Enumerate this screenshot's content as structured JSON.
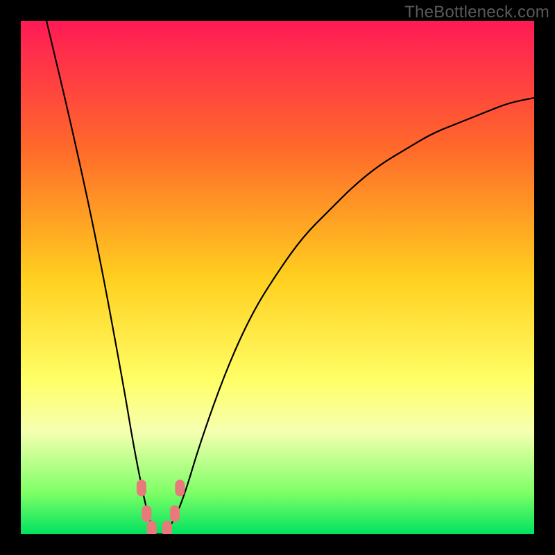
{
  "watermark": "TheBottleneck.com",
  "chart_data": {
    "type": "line",
    "title": "",
    "xlabel": "",
    "ylabel": "",
    "xlim": [
      0,
      100
    ],
    "ylim": [
      0,
      100
    ],
    "gradient_stops": [
      {
        "offset": 0,
        "color": "#ff1a55"
      },
      {
        "offset": 25,
        "color": "#ff6a2a"
      },
      {
        "offset": 50,
        "color": "#ffcf1f"
      },
      {
        "offset": 70,
        "color": "#ffff66"
      },
      {
        "offset": 80,
        "color": "#f6ffb0"
      },
      {
        "offset": 92,
        "color": "#7dff66"
      },
      {
        "offset": 100,
        "color": "#00e25f"
      }
    ],
    "series": [
      {
        "name": "bottleneck-curve",
        "x": [
          5,
          10,
          15,
          20,
          22,
          24,
          25,
          26,
          27,
          28,
          30,
          32,
          35,
          40,
          45,
          50,
          55,
          60,
          65,
          70,
          75,
          80,
          85,
          90,
          95,
          100
        ],
        "y": [
          100,
          79,
          56,
          29,
          17,
          7,
          3,
          0,
          0,
          0,
          3,
          8,
          18,
          32,
          43,
          51,
          58,
          63,
          68,
          72,
          75,
          78,
          80,
          82,
          84,
          85
        ]
      }
    ],
    "markers": {
      "color": "#e77a7a",
      "points": [
        {
          "x": 23.5,
          "y": 9
        },
        {
          "x": 24.5,
          "y": 4
        },
        {
          "x": 25.5,
          "y": 1
        },
        {
          "x": 28.5,
          "y": 1
        },
        {
          "x": 30.0,
          "y": 4
        },
        {
          "x": 31.0,
          "y": 9
        }
      ]
    }
  }
}
